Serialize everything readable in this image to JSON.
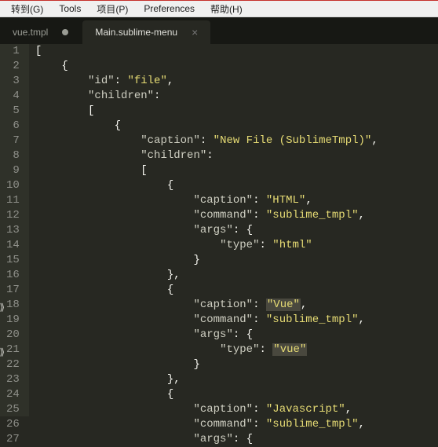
{
  "menubar": {
    "items": [
      "转到(G)",
      "Tools",
      "项目(P)",
      "Preferences",
      "帮助(H)"
    ]
  },
  "tabs": [
    {
      "label": "vue.tmpl",
      "dirty": true,
      "active": false
    },
    {
      "label": "Main.sublime-menu",
      "dirty": false,
      "active": true
    }
  ],
  "gutter": {
    "start": 1,
    "end": 27,
    "marks": [
      18,
      21
    ]
  },
  "code_lines": [
    {
      "indent": 0,
      "tokens": [
        {
          "t": "p",
          "v": "["
        }
      ]
    },
    {
      "indent": 1,
      "tokens": [
        {
          "t": "p",
          "v": "{"
        }
      ]
    },
    {
      "indent": 2,
      "tokens": [
        {
          "t": "k",
          "v": "\"id\""
        },
        {
          "t": "p",
          "v": ": "
        },
        {
          "t": "s",
          "v": "\"file\""
        },
        {
          "t": "p",
          "v": ","
        }
      ]
    },
    {
      "indent": 2,
      "tokens": [
        {
          "t": "k",
          "v": "\"children\""
        },
        {
          "t": "p",
          "v": ":"
        }
      ]
    },
    {
      "indent": 2,
      "tokens": [
        {
          "t": "p",
          "v": "["
        }
      ]
    },
    {
      "indent": 3,
      "tokens": [
        {
          "t": "p",
          "v": "{"
        }
      ]
    },
    {
      "indent": 4,
      "tokens": [
        {
          "t": "k",
          "v": "\"caption\""
        },
        {
          "t": "p",
          "v": ": "
        },
        {
          "t": "s",
          "v": "\"New File (SublimeTmpl)\""
        },
        {
          "t": "p",
          "v": ","
        }
      ]
    },
    {
      "indent": 4,
      "tokens": [
        {
          "t": "k",
          "v": "\"children\""
        },
        {
          "t": "p",
          "v": ":"
        }
      ]
    },
    {
      "indent": 4,
      "tokens": [
        {
          "t": "p",
          "v": "["
        }
      ]
    },
    {
      "indent": 5,
      "tokens": [
        {
          "t": "p",
          "v": "{"
        }
      ]
    },
    {
      "indent": 6,
      "tokens": [
        {
          "t": "k",
          "v": "\"caption\""
        },
        {
          "t": "p",
          "v": ": "
        },
        {
          "t": "s",
          "v": "\"HTML\""
        },
        {
          "t": "p",
          "v": ","
        }
      ]
    },
    {
      "indent": 6,
      "tokens": [
        {
          "t": "k",
          "v": "\"command\""
        },
        {
          "t": "p",
          "v": ": "
        },
        {
          "t": "s",
          "v": "\"sublime_tmpl\""
        },
        {
          "t": "p",
          "v": ","
        }
      ]
    },
    {
      "indent": 6,
      "tokens": [
        {
          "t": "k",
          "v": "\"args\""
        },
        {
          "t": "p",
          "v": ": {"
        }
      ]
    },
    {
      "indent": 7,
      "tokens": [
        {
          "t": "k",
          "v": "\"type\""
        },
        {
          "t": "p",
          "v": ": "
        },
        {
          "t": "s",
          "v": "\"html\""
        }
      ]
    },
    {
      "indent": 6,
      "tokens": [
        {
          "t": "p",
          "v": "}"
        }
      ]
    },
    {
      "indent": 5,
      "tokens": [
        {
          "t": "p",
          "v": "},"
        }
      ]
    },
    {
      "indent": 5,
      "tokens": [
        {
          "t": "p",
          "v": "{"
        }
      ]
    },
    {
      "indent": 6,
      "tokens": [
        {
          "t": "k",
          "v": "\"caption\""
        },
        {
          "t": "p",
          "v": ": "
        },
        {
          "t": "h",
          "v": "\"Vue\""
        },
        {
          "t": "p",
          "v": ","
        }
      ]
    },
    {
      "indent": 6,
      "tokens": [
        {
          "t": "k",
          "v": "\"command\""
        },
        {
          "t": "p",
          "v": ": "
        },
        {
          "t": "s",
          "v": "\"sublime_tmpl\""
        },
        {
          "t": "p",
          "v": ","
        }
      ]
    },
    {
      "indent": 6,
      "tokens": [
        {
          "t": "k",
          "v": "\"args\""
        },
        {
          "t": "p",
          "v": ": {"
        }
      ]
    },
    {
      "indent": 7,
      "tokens": [
        {
          "t": "k",
          "v": "\"type\""
        },
        {
          "t": "p",
          "v": ": "
        },
        {
          "t": "h",
          "v": "\"vue\""
        }
      ]
    },
    {
      "indent": 6,
      "tokens": [
        {
          "t": "p",
          "v": "}"
        }
      ]
    },
    {
      "indent": 5,
      "tokens": [
        {
          "t": "p",
          "v": "},"
        }
      ]
    },
    {
      "indent": 5,
      "tokens": [
        {
          "t": "p",
          "v": "{"
        }
      ]
    },
    {
      "indent": 6,
      "tokens": [
        {
          "t": "k",
          "v": "\"caption\""
        },
        {
          "t": "p",
          "v": ": "
        },
        {
          "t": "s",
          "v": "\"Javascript\""
        },
        {
          "t": "p",
          "v": ","
        }
      ]
    },
    {
      "indent": 6,
      "tokens": [
        {
          "t": "k",
          "v": "\"command\""
        },
        {
          "t": "p",
          "v": ": "
        },
        {
          "t": "s",
          "v": "\"sublime_tmpl\""
        },
        {
          "t": "p",
          "v": ","
        }
      ]
    },
    {
      "indent": 6,
      "tokens": [
        {
          "t": "k",
          "v": "\"args\""
        },
        {
          "t": "p",
          "v": ": {"
        }
      ]
    }
  ],
  "indent_unit": "    "
}
